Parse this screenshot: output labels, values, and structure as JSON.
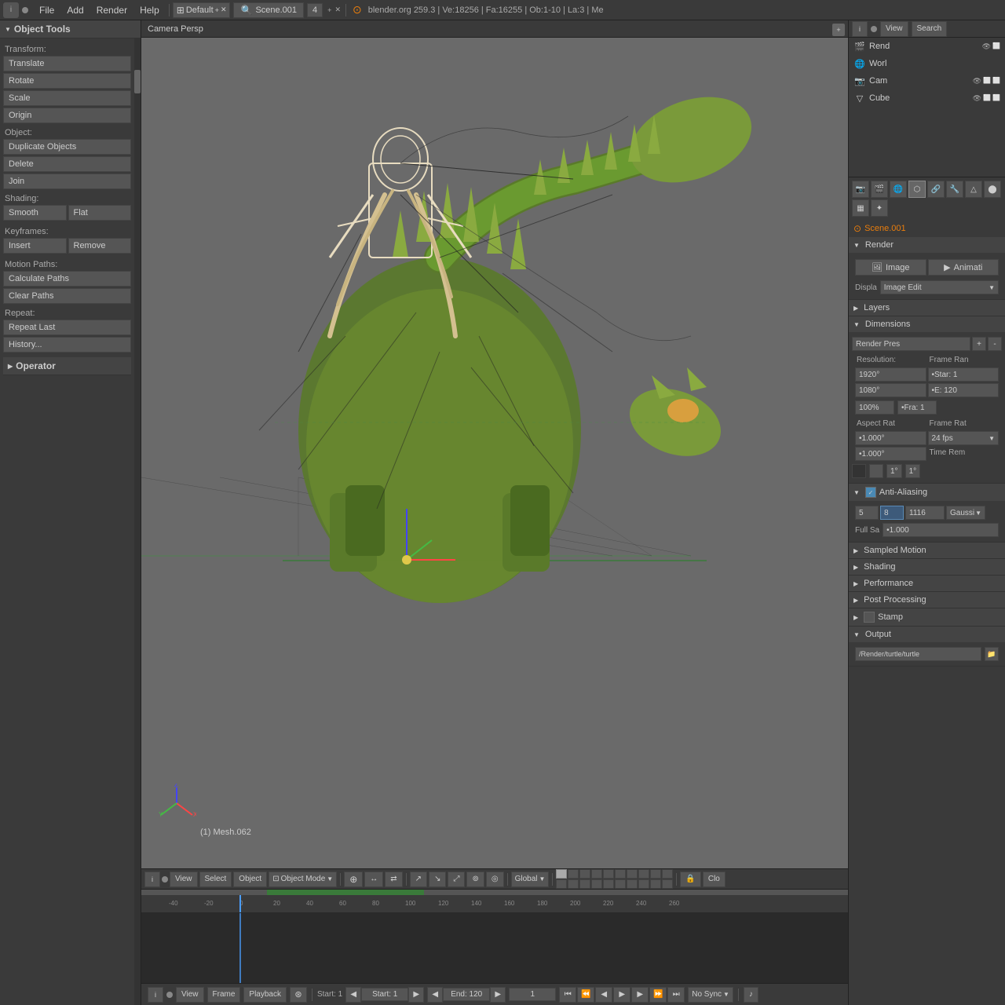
{
  "app": {
    "title": "Blender",
    "version": "blender.org 259.3 | Ve:18256 | Fa:16255 | Ob:1-10 | La:3 | Me"
  },
  "topbar": {
    "icon_label": "i",
    "dot": "",
    "menus": [
      "File",
      "Add",
      "Render",
      "Help"
    ],
    "layout": "Default",
    "scene": "Scene.001",
    "blender_icon": "⊕"
  },
  "left_panel": {
    "title": "Object Tools",
    "sections": {
      "transform": {
        "label": "Transform:",
        "buttons": [
          "Translate",
          "Rotate",
          "Scale"
        ]
      },
      "origin": {
        "button": "Origin"
      },
      "object": {
        "label": "Object:",
        "buttons": [
          "Duplicate Objects",
          "Delete",
          "Join"
        ]
      },
      "shading": {
        "label": "Shading:",
        "buttons": [
          "Smooth",
          "Flat"
        ]
      },
      "keyframes": {
        "label": "Keyframes:",
        "buttons": [
          "Insert",
          "Remove"
        ]
      },
      "motion_paths": {
        "label": "Motion Paths:",
        "buttons": [
          "Calculate Paths",
          "Clear Paths"
        ]
      },
      "repeat": {
        "label": "Repeat:",
        "buttons": [
          "Repeat Last",
          "History..."
        ]
      }
    },
    "operator_label": "Operator"
  },
  "viewport": {
    "label": "Camera Persp",
    "mesh_label": "(1) Mesh.062"
  },
  "toolbar_bottom": {
    "view": "View",
    "select": "Select",
    "object": "Object",
    "mode": "Object Mode",
    "global": "Global",
    "close": "Clo"
  },
  "right_panel": {
    "view": "View",
    "search": "Search",
    "scene_name": "Scene.001",
    "outliner_items": [
      {
        "name": "Rend",
        "icon": "🎬",
        "has_eye": true,
        "selected": false
      },
      {
        "name": "Worl",
        "icon": "🌐",
        "has_eye": false,
        "selected": false
      },
      {
        "name": "Cam",
        "icon": "📷",
        "has_eye": true,
        "selected": false
      },
      {
        "name": "Cube",
        "icon": "▽",
        "has_eye": true,
        "selected": false
      }
    ],
    "properties": {
      "scene_label": "Scene.001",
      "render_section": {
        "label": "Render",
        "image_btn": "Image",
        "animati_btn": "Animati",
        "display_label": "Displa",
        "display_value": "Image Edit"
      },
      "layers_section": {
        "label": "Layers"
      },
      "dimensions_section": {
        "label": "Dimensions",
        "render_pres": "Render Pres",
        "resolution_label": "Resolution:",
        "frame_range_label": "Frame Ran",
        "width": "1920°",
        "height": "1080°",
        "start": "•Star: 1",
        "end": "•E: 120",
        "pct": "100%",
        "fra": "•Fra: 1",
        "aspect_label": "Aspect Rat",
        "framerate_label": "Frame Rat",
        "aspect_x": "•1.000°",
        "aspect_y": "•1.000°",
        "framerate": "24 fps",
        "time_rem_label": "Time Rem",
        "time_rem_1": "1°",
        "time_rem_2": "1°"
      },
      "anti_aliasing": {
        "label": "Anti-Aliasing",
        "enabled": true,
        "val1": "5",
        "val2": "8",
        "val3": "1116",
        "val4": "Gaussi",
        "full_sample": "Full Sa",
        "full_val": "•1.000"
      },
      "sampled_motion": {
        "label": "Sampled Motion"
      },
      "shading": {
        "label": "Shading"
      },
      "performance": {
        "label": "Performance"
      },
      "post_processing": {
        "label": "Post Processing"
      },
      "stamp": {
        "label": "Stamp"
      },
      "output": {
        "label": "Output",
        "path": "/Render/turtle/turtle"
      }
    }
  },
  "timeline": {
    "start_label": "Start: 1",
    "end_label": "End: 120",
    "current_frame": "1",
    "no_sync": "No Sync",
    "markers": [
      "-40",
      "-20",
      "0",
      "20",
      "40",
      "60",
      "80",
      "100",
      "120",
      "140",
      "160",
      "180",
      "200",
      "220",
      "240",
      "260"
    ]
  }
}
